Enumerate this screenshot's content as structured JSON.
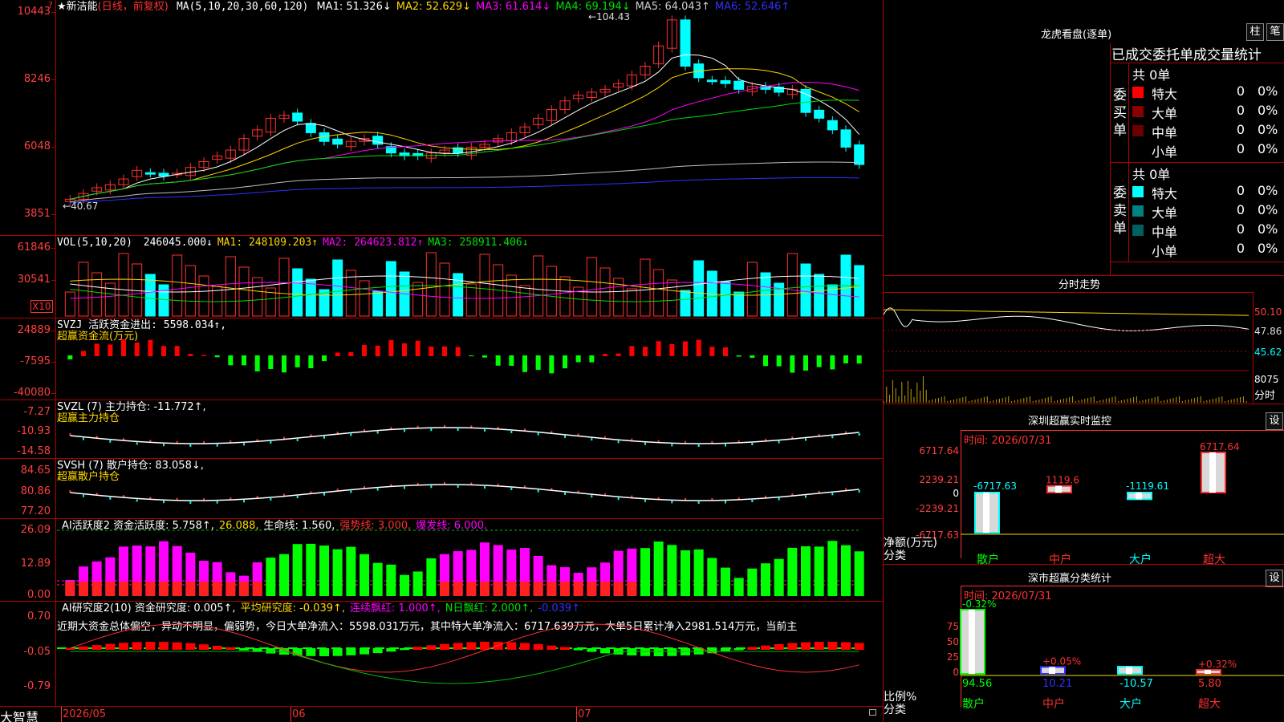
{
  "stock": {
    "name": "★新洁能",
    "mode": "(日线，前复权)"
  },
  "ma": {
    "label": "MA(5,10,20,30,60,120)",
    "items": [
      {
        "text": "MA1: 51.326↓",
        "color": "#ffffff"
      },
      {
        "text": "MA2: 52.629↓",
        "color": "#ffd700"
      },
      {
        "text": "MA3: 61.614↓",
        "color": "#ff00ff"
      },
      {
        "text": "MA4: 69.194↓",
        "color": "#00e000"
      },
      {
        "text": "MA5: 64.043↑",
        "color": "#d0d0d0"
      },
      {
        "text": "MA6: 52.646↑",
        "color": "#3030ff"
      }
    ]
  },
  "price_axis": [
    "10443",
    "8246",
    "6048",
    "3851"
  ],
  "price_marks": {
    "high": "104.43",
    "low": "40.67"
  },
  "vol": {
    "label": "VOL(5,10,20)",
    "items": [
      {
        "text": "246045.000↓",
        "color": "#ffffff"
      },
      {
        "text": "MA1: 248109.203↑",
        "color": "#ffd700"
      },
      {
        "text": "MA2: 264623.812↑",
        "color": "#ff00ff"
      },
      {
        "text": "MA3: 258911.406↓",
        "color": "#00e000"
      }
    ],
    "axis": [
      "61846",
      "30541"
    ],
    "unit": "X10"
  },
  "svzj": {
    "label": "SVZJ  活跃资金进出: 5598.034↑,",
    "sub": "超赢资金流(万元)",
    "axis": [
      "24889",
      "-7595",
      "-40080"
    ]
  },
  "svzl": {
    "label": "SVZL (7) 主力持仓: -11.772↑,",
    "sub": "超赢主力持仓",
    "axis": [
      "-7.27",
      "-10.93",
      "-14.58"
    ]
  },
  "svsh": {
    "label": "SVSH (7) 散户持仓: 83.058↓,",
    "sub": "超赢散户持仓",
    "axis": [
      "84.65",
      "80.86",
      "77.20"
    ]
  },
  "ai1": {
    "items": [
      {
        "text": "AI活跃度2 资金活跃度: 5.758↑,",
        "color": "#ffffff"
      },
      {
        "text": "26.088,",
        "color": "#ffd700"
      },
      {
        "text": "生命线: 1.560,",
        "color": "#ffffff"
      },
      {
        "text": "强势线: 3.000,",
        "color": "#ff3030"
      },
      {
        "text": "爆发线: 6.000,",
        "color": "#ff00ff"
      }
    ],
    "axis": [
      "26.09",
      "12.89",
      "0.00"
    ]
  },
  "ai2": {
    "items": [
      {
        "text": "AI研究度2(10) 资金研究度: 0.005↑,",
        "color": "#ffffff"
      },
      {
        "text": "平均研究度: -0.039↑,",
        "color": "#ffd700"
      },
      {
        "text": "连续飘红: 1.000↑,",
        "color": "#ff00ff"
      },
      {
        "text": "N日飘红: 2.000↑,",
        "color": "#00e000"
      },
      {
        "text": "-0.039↑",
        "color": "#3030ff"
      }
    ],
    "comment": "近期大资金总体偏空，异动不明显，偏弱势，今日大单净流入：5598.031万元，其中特大单净流入：6717.639万元，大单5日累计净入2981.514万元，当前主",
    "axis": [
      "0.70",
      "-0.05",
      "-0.79"
    ]
  },
  "dates": [
    "2026/05",
    "06",
    "07"
  ],
  "brand": "大智慧",
  "lhb": {
    "title": "龙虎看盘(逐单)",
    "btn1": "柱",
    "btn2": "笔",
    "subtitle": "已成交委托单成交量统计",
    "buy": {
      "side": "委买单",
      "total": "共 0单",
      "rows": [
        {
          "name": "特大",
          "v": "0",
          "p": "0%",
          "color": "#ff0000"
        },
        {
          "name": "大单",
          "v": "0",
          "p": "0%",
          "color": "#8b0000"
        },
        {
          "name": "中单",
          "v": "0",
          "p": "0%",
          "color": "#6b0000"
        },
        {
          "name": "小单",
          "v": "0",
          "p": "0%",
          "color": ""
        }
      ]
    },
    "sell": {
      "side": "委卖单",
      "total": "共 0单",
      "rows": [
        {
          "name": "特大",
          "v": "0",
          "p": "0%",
          "color": "#00ffff"
        },
        {
          "name": "大单",
          "v": "0",
          "p": "0%",
          "color": "#008080"
        },
        {
          "name": "中单",
          "v": "0",
          "p": "0%",
          "color": "#006060"
        },
        {
          "name": "小单",
          "v": "0",
          "p": "0%",
          "color": ""
        }
      ]
    }
  },
  "fenshi": {
    "title": "分时走势",
    "axis": [
      "50.10",
      "47.86",
      "45.62"
    ],
    "vol_axis": "8075",
    "unit": "分时"
  },
  "sz_monitor": {
    "title": "深圳超赢实时监控",
    "btn": "设",
    "time": "时间: 2026/07/31",
    "axis": [
      "6717.64",
      "2239.21",
      "0",
      "-2239.21",
      "-6717.63"
    ],
    "ylabel": "净额(万元)",
    "xlabel": "分类",
    "bars": [
      {
        "cat": "散户",
        "label": "-6717.63",
        "value": -6717.63
      },
      {
        "cat": "中户",
        "label": "1119.6",
        "value": 1119.6
      },
      {
        "cat": "大户",
        "label": "-1119.61",
        "value": -1119.61
      },
      {
        "cat": "超大",
        "label": "6717.64",
        "value": 6717.64
      }
    ]
  },
  "sz_class": {
    "title": "深市超赢分类统计",
    "btn": "设",
    "time": "时间: 2026/07/31",
    "axis": [
      "75",
      "50",
      "25",
      "0"
    ],
    "ylabel": "比例%",
    "xlabel": "分类",
    "bars": [
      {
        "cat": "散户",
        "top": "-0.32%",
        "bottom": "94.56",
        "value": 94.56
      },
      {
        "cat": "中户",
        "top": "+0.05%",
        "bottom": "10.21",
        "value": 10.21
      },
      {
        "cat": "大户",
        "top": "",
        "bottom": "-10.57",
        "value": 10.57
      },
      {
        "cat": "超大",
        "top": "+0.32%",
        "bottom": "5.80",
        "value": 5.8
      }
    ]
  }
}
